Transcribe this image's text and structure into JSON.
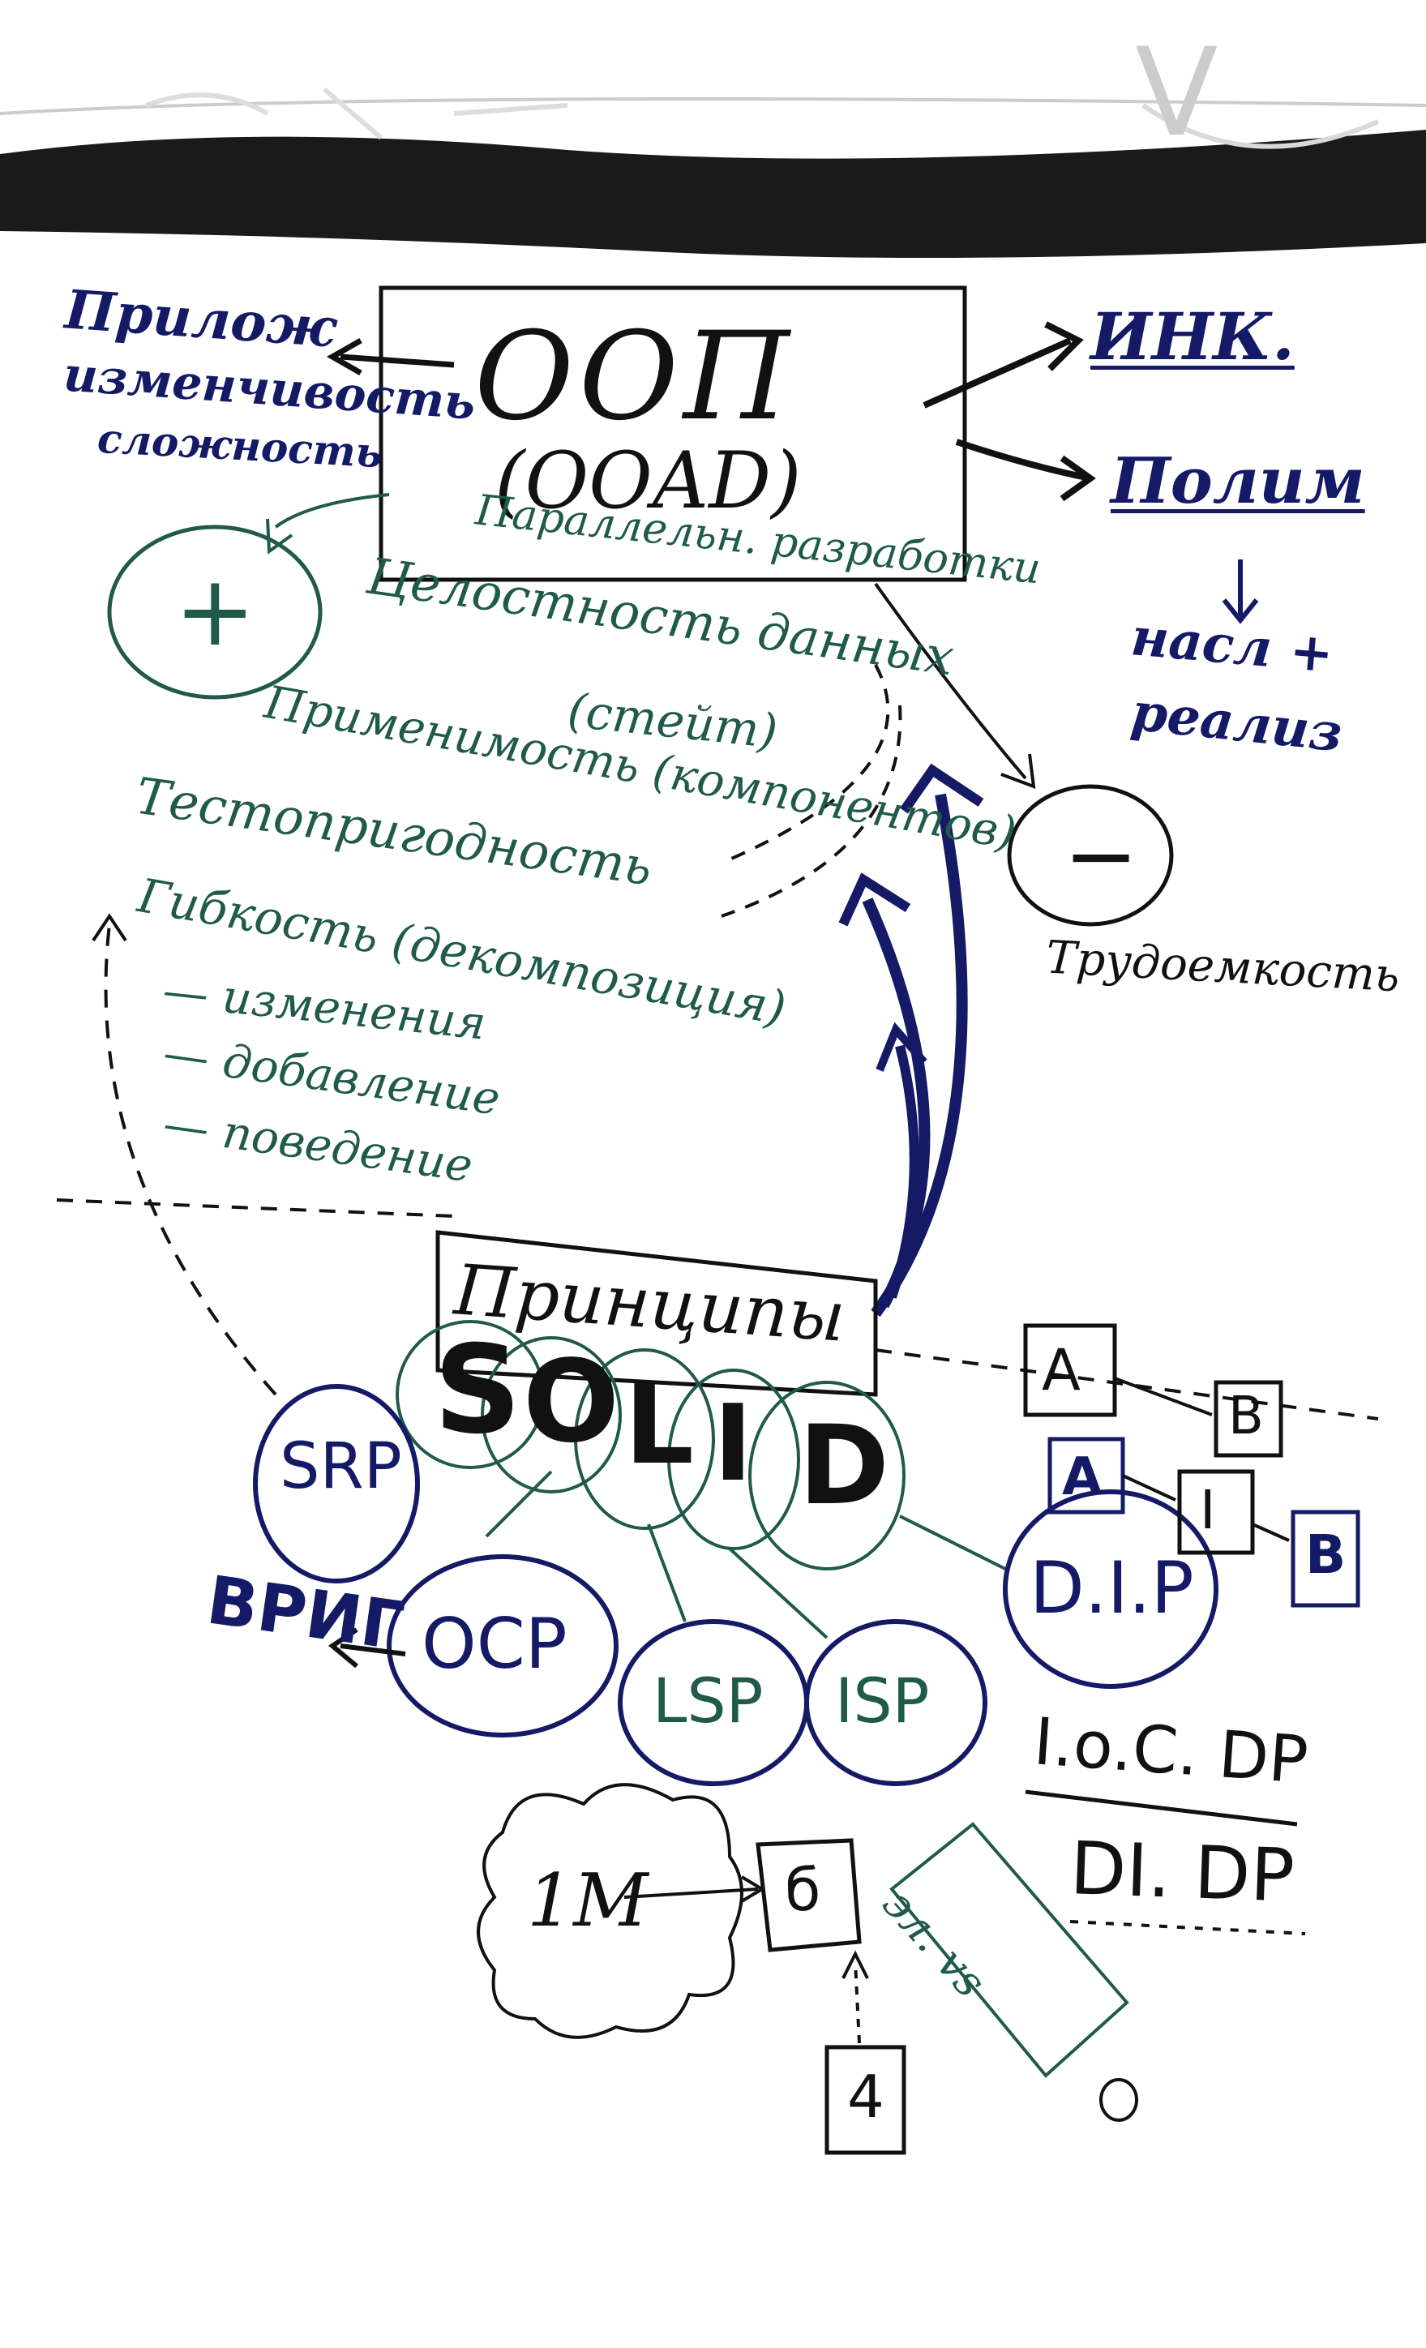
{
  "colors": {
    "navy_marker": "#141a66",
    "green_marker": "#1f5a4a",
    "black_marker": "#111111",
    "board_top": "#1a1a1a",
    "paper": "#ffffff"
  },
  "top_corner_mark": "V",
  "ooad_box": {
    "title": "OOП",
    "subtitle": "(OOAD)"
  },
  "left_navy_notes": [
    "Прилож",
    "изменчивость",
    "сложность"
  ],
  "right_navy": {
    "ink_label": "ИНК.",
    "polim_label": "Полим",
    "inherit_label": "насл +",
    "realiz_label": "реализ"
  },
  "plus_circle": "+",
  "minus_circle": "−",
  "labor_label": "Трудоемкость",
  "green_notes": [
    "Параллельн. разработки",
    "Целостность данных",
    "(стейт)",
    "Применимость (компонентов)",
    "Тестопригодность",
    "Гибкость (декомпозиция)",
    "— изменения",
    "— добавление",
    "— поведение"
  ],
  "principles_label": "Принципы",
  "solid_letters": [
    "S",
    "O",
    "L",
    "I",
    "D"
  ],
  "solid_dots": ".",
  "principle_ovals": {
    "srp": "SRP",
    "ocp": "OCP",
    "lsp": "LSP",
    "isp": "ISP",
    "dip": "D.I.P"
  },
  "vrig_label": "ВРИГ",
  "right_boxes": {
    "a_top": "A",
    "b_top": "B",
    "a_mid": "A",
    "i_mid": "I",
    "b_mid": "B"
  },
  "ioc_label": "I.o.C. DP",
  "di_label": "DI. DP",
  "cloud_label": "1M",
  "small_box_top": "б",
  "small_box_bottom": "4",
  "green_diagonal": "эл. vs"
}
